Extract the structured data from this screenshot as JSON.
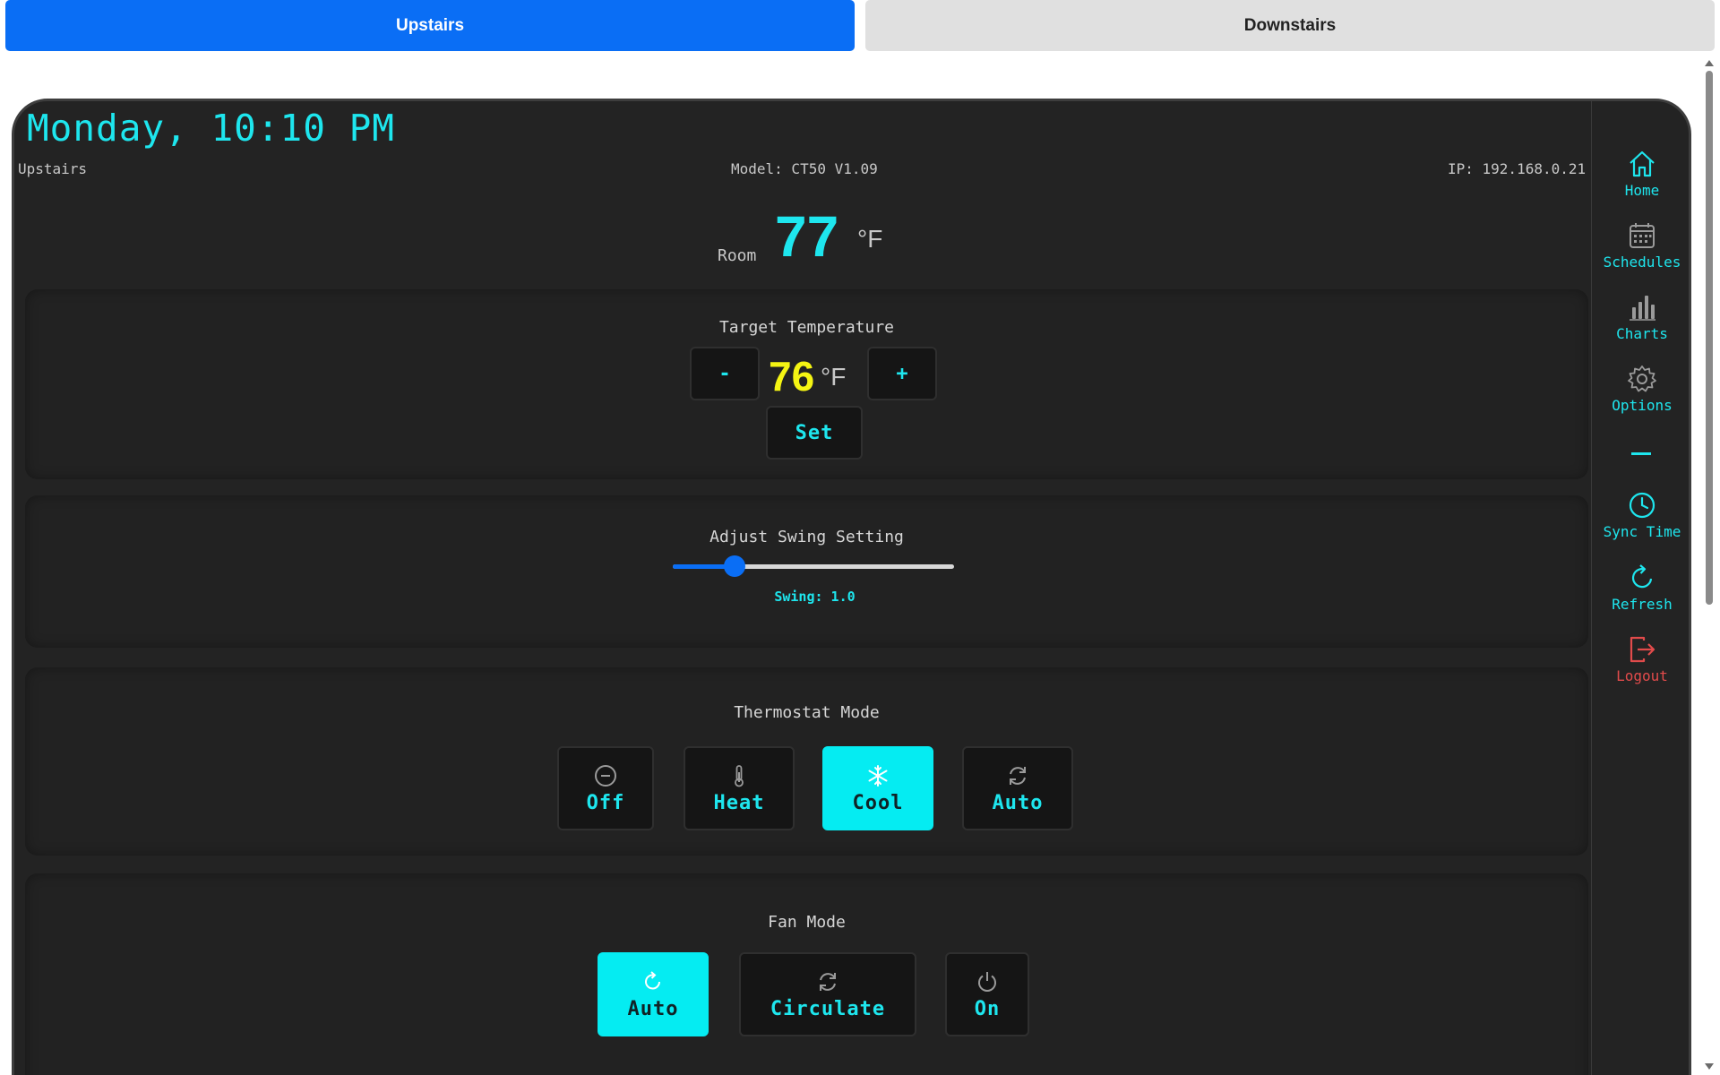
{
  "zones": {
    "tabs": [
      {
        "label": "Upstairs",
        "active": true
      },
      {
        "label": "Downstairs",
        "active": false
      }
    ]
  },
  "device": {
    "clock": "Monday, 10:10 PM",
    "name": "Upstairs",
    "model": "Model: CT50 V1.09",
    "ip": "IP: 192.168.0.21"
  },
  "room": {
    "label": "Room",
    "value": "77",
    "unit": "°F"
  },
  "target": {
    "title": "Target Temperature",
    "minus_label": "-",
    "plus_label": "+",
    "value": "76",
    "unit": "°F",
    "set_label": "Set"
  },
  "swing": {
    "title": "Adjust Swing Setting",
    "readout": "Swing: 1.0",
    "level_fraction": 0.22
  },
  "thermostat_mode": {
    "title": "Thermostat Mode",
    "options": [
      {
        "label": "Off",
        "icon": "minus-circle-icon",
        "selected": false
      },
      {
        "label": "Heat",
        "icon": "thermometer-icon",
        "selected": false
      },
      {
        "label": "Cool",
        "icon": "snowflake-icon",
        "selected": true
      },
      {
        "label": "Auto",
        "icon": "cycle-icon",
        "selected": false
      }
    ]
  },
  "fan_mode": {
    "title": "Fan Mode",
    "options": [
      {
        "label": "Auto",
        "icon": "refresh-icon",
        "selected": true
      },
      {
        "label": "Circulate",
        "icon": "cycle-icon",
        "selected": false
      },
      {
        "label": "On",
        "icon": "power-icon",
        "selected": false
      }
    ]
  },
  "sidebar": {
    "items": [
      {
        "label": "Home",
        "icon": "home-icon"
      },
      {
        "label": "Schedules",
        "icon": "calendar-icon"
      },
      {
        "label": "Charts",
        "icon": "bar-chart-icon"
      },
      {
        "label": "Options",
        "icon": "gear-icon"
      },
      {
        "label": "Sync Time",
        "icon": "clock-icon"
      },
      {
        "label": "Refresh",
        "icon": "refresh-icon"
      },
      {
        "label": "Logout",
        "icon": "logout-icon"
      }
    ]
  },
  "colors": {
    "accent": "#1ee6ee",
    "selected": "#05ecf2",
    "target": "#f5f513",
    "brand_blue": "#0a6ef5",
    "logout": "#e24b4b",
    "panel": "#232323"
  }
}
